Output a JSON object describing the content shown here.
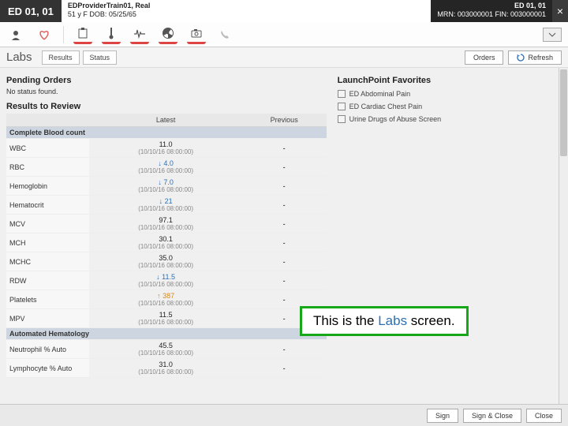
{
  "header": {
    "context": "ED 01, 01",
    "patient_line1": "EDProviderTrain01, Real",
    "patient_line2": "51 y   F   DOB: 05/25/65",
    "right_line1": "ED 01, 01",
    "right_line2": "MRN: 003000001   FIN: 003000001"
  },
  "subhead": {
    "title": "Labs",
    "tabs": [
      "Results",
      "Status"
    ],
    "orders_btn": "Orders",
    "refresh_btn": "Refresh"
  },
  "pending": {
    "heading": "Pending Orders",
    "empty": "No status found."
  },
  "columns": {
    "latest": "Latest",
    "previous": "Previous"
  },
  "results_heading": "Results to Review",
  "panels": [
    {
      "name": "Complete Blood count",
      "rows": [
        {
          "label": "WBC",
          "value": "11.0",
          "ts": "(10/10/16 08:00:00)",
          "prev": "-",
          "color": ""
        },
        {
          "label": "RBC",
          "value": "↓ 4.0",
          "ts": "(10/10/16 08:00:00)",
          "prev": "-",
          "color": "blue"
        },
        {
          "label": "Hemoglobin",
          "value": "↓ 7.0",
          "ts": "(10/10/16 08:00:00)",
          "prev": "-",
          "color": "blue"
        },
        {
          "label": "Hematocrit",
          "value": "↓ 21",
          "ts": "(10/10/16 08:00:00)",
          "prev": "-",
          "color": "blue"
        },
        {
          "label": "MCV",
          "value": "97.1",
          "ts": "(10/10/16 08:00:00)",
          "prev": "-",
          "color": ""
        },
        {
          "label": "MCH",
          "value": "30.1",
          "ts": "(10/10/16 08:00:00)",
          "prev": "-",
          "color": ""
        },
        {
          "label": "MCHC",
          "value": "35.0",
          "ts": "(10/10/16 08:00:00)",
          "prev": "-",
          "color": ""
        },
        {
          "label": "RDW",
          "value": "↓ 11.5",
          "ts": "(10/10/16 08:00:00)",
          "prev": "-",
          "color": "blue"
        },
        {
          "label": "Platelets",
          "value": "↑ 387",
          "ts": "(10/10/16 08:00:00)",
          "prev": "-",
          "color": "orange"
        },
        {
          "label": "MPV",
          "value": "11.5",
          "ts": "(10/10/16 08:00:00)",
          "prev": "-",
          "color": ""
        }
      ]
    },
    {
      "name": "Automated Hematology",
      "rows": [
        {
          "label": "Neutrophil % Auto",
          "value": "45.5",
          "ts": "(10/10/16 08:00:00)",
          "prev": "-",
          "color": ""
        },
        {
          "label": "Lymphocyte % Auto",
          "value": "31.0",
          "ts": "(10/10/16 08:00:00)",
          "prev": "-",
          "color": ""
        }
      ]
    }
  ],
  "favorites": {
    "heading": "LaunchPoint Favorites",
    "items": [
      "ED Abdominal Pain",
      "ED Cardiac Chest Pain",
      "Urine Drugs of Abuse Screen"
    ]
  },
  "footer": {
    "sign": "Sign",
    "sign_close": "Sign & Close",
    "close": "Close"
  },
  "callout": {
    "pre": "This is the ",
    "em": "Labs",
    "post": " screen."
  }
}
